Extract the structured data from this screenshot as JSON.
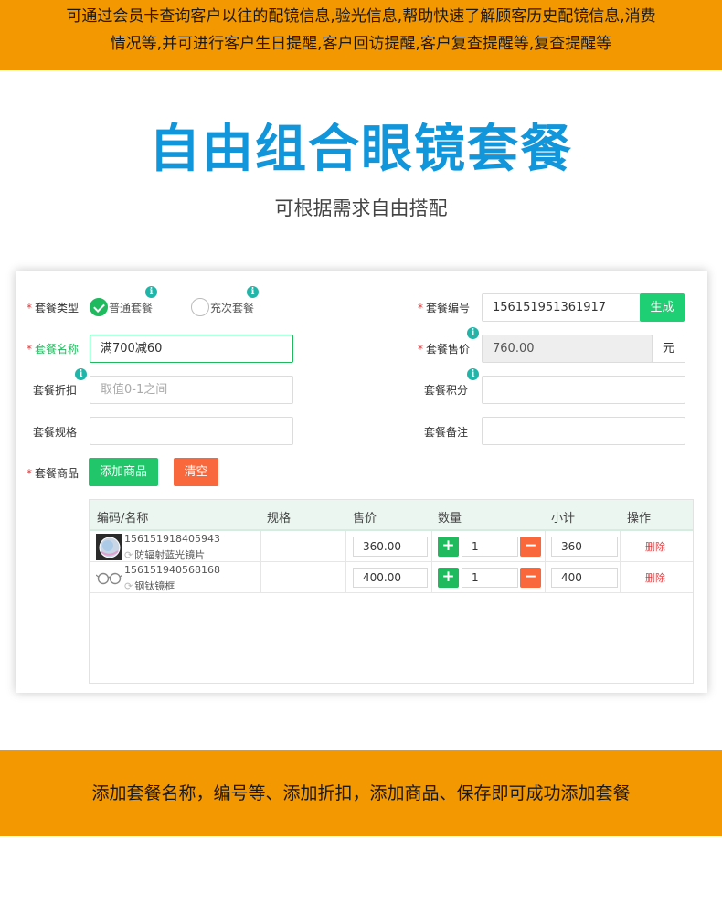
{
  "top_banner": {
    "line1": "可通过会员卡查询客户以往的配镜信息,验光信息,帮助快速了解顾客历史配镜信息,消费",
    "line2": "情况等,并可进行客户生日提醒,客户回访提醒,客户复查提醒等,复查提醒等"
  },
  "title": "自由组合眼镜套餐",
  "subtitle": "可根据需求自由搭配",
  "form": {
    "type_label": "套餐类型",
    "type_options": [
      "普通套餐",
      "充次套餐"
    ],
    "type_selected": "普通套餐",
    "code_label": "套餐编号",
    "code_value": "156151951361917",
    "generate_btn": "生成",
    "name_label": "套餐名称",
    "name_value": "满700减60",
    "price_label": "套餐售价",
    "price_value": "760.00",
    "price_unit": "元",
    "discount_label": "套餐折扣",
    "discount_placeholder": "取值0-1之间",
    "points_label": "套餐积分",
    "points_value": "",
    "spec_label": "套餐规格",
    "spec_value": "",
    "remark_label": "套餐备注",
    "remark_value": "",
    "goods_label": "套餐商品",
    "add_goods_btn": "添加商品",
    "clear_btn": "清空",
    "info_icon": "info-icon"
  },
  "table": {
    "headers": [
      "编码/名称",
      "规格",
      "售价",
      "数量",
      "小计",
      "操作"
    ],
    "rows": [
      {
        "code": "156151918405943",
        "name": "防辐射蓝光镜片",
        "spec": "",
        "price": "360.00",
        "qty": "1",
        "subtotal": "360",
        "action": "删除",
        "thumb": "lens-icon"
      },
      {
        "code": "156151940568168",
        "name": "钢钛镜框",
        "spec": "",
        "price": "400.00",
        "qty": "1",
        "subtotal": "400",
        "action": "删除",
        "thumb": "glasses-frame-icon"
      }
    ]
  },
  "bottom_banner": "添加套餐名称，编号等、添加折扣，添加商品、保存即可成功添加套餐",
  "colors": {
    "accent_orange": "#f39800",
    "title_blue": "#1296db",
    "green": "#1fba5d",
    "red_orange": "#f9683c"
  }
}
